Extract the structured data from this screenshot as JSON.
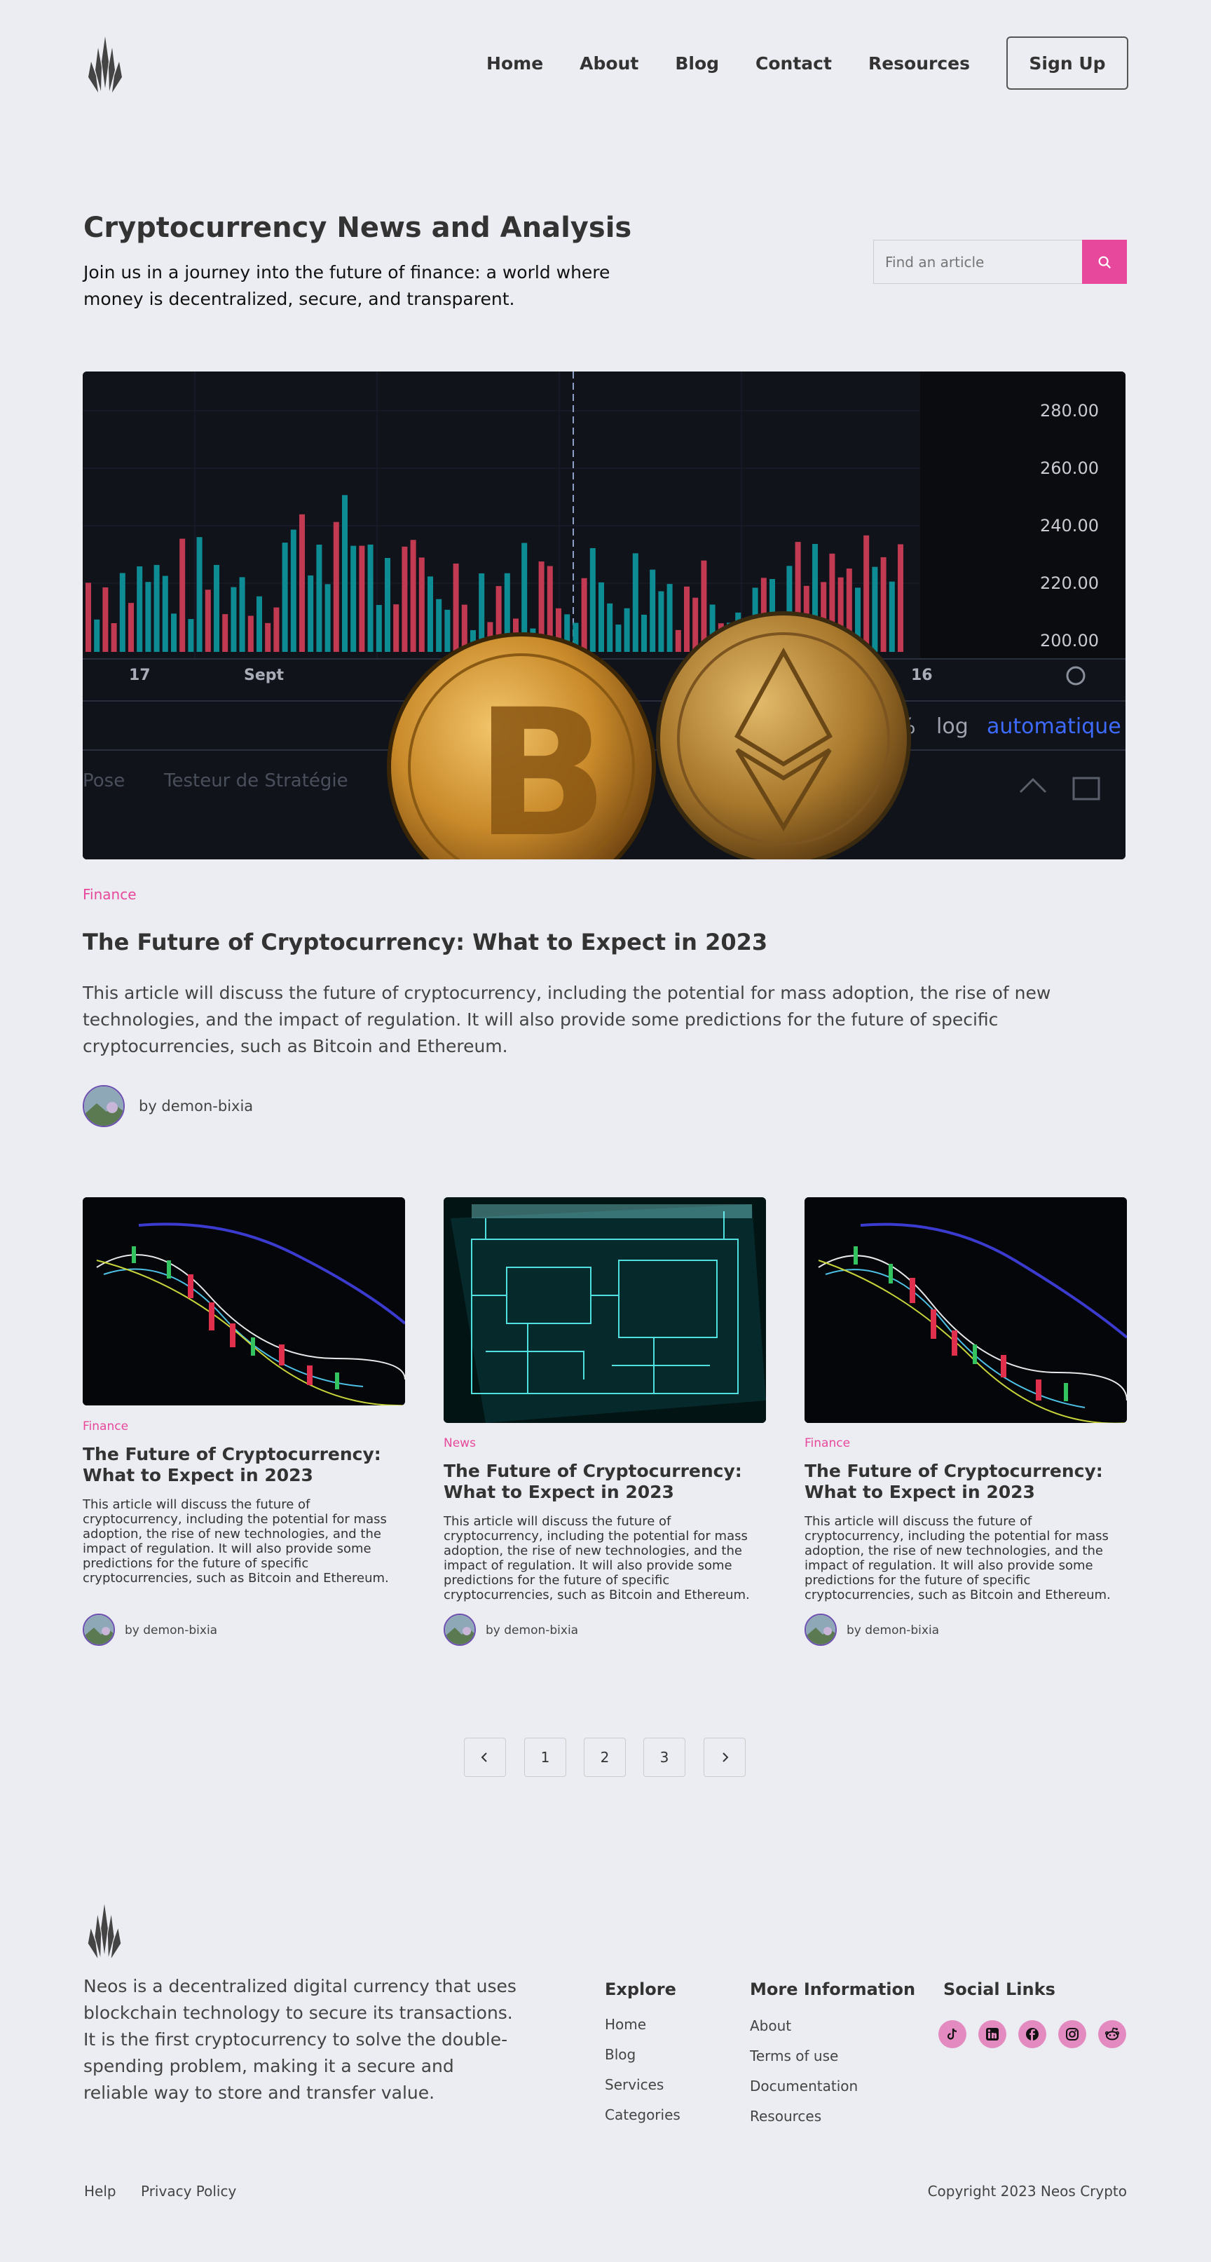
{
  "header": {
    "nav": [
      "Home",
      "About",
      "Blog",
      "Contact",
      "Resources"
    ],
    "signup_label": "Sign Up"
  },
  "hero": {
    "title": "Cryptocurrency News and Analysis",
    "subtitle": "Join us in a journey into the future of finance: a world where money is decentralized, secure, and transparent.",
    "search_placeholder": "Find an article"
  },
  "featured": {
    "chart_ticks": [
      "280.00",
      "260.00",
      "240.00",
      "220.00",
      "200.00"
    ],
    "chart_x_labels": [
      "17",
      "Sept",
      "16"
    ],
    "chart_controls": [
      "%",
      "log",
      "automatique"
    ],
    "chart_bottom": [
      "Pose",
      "Testeur de Stratégie"
    ],
    "tag": "Finance",
    "title": "The Future of Cryptocurrency: What to Expect in 2023",
    "excerpt": "This article will discuss the future of cryptocurrency, including the potential for mass adoption, the rise of new technologies, and the impact of regulation. It will also provide some predictions for the future of specific cryptocurrencies, such as Bitcoin and Ethereum.",
    "author": "by demon-bixia"
  },
  "posts": [
    {
      "tag": "Finance",
      "title": "The Future of Cryptocurrency: What to Expect in 2023",
      "excerpt": "This article will discuss the future of cryptocurrency, including the potential for mass adoption, the rise of new technologies, and the impact of regulation. It will also provide some predictions for the future of specific cryptocurrencies, such as Bitcoin and Ethereum.",
      "author": "by demon-bixia"
    },
    {
      "tag": "News",
      "title": "The Future of Cryptocurrency: What to Expect in 2023",
      "excerpt": "This article will discuss the future of cryptocurrency, including the potential for mass adoption, the rise of new technologies, and the impact of regulation. It will also provide some predictions for the future of specific cryptocurrencies, such as Bitcoin and Ethereum.",
      "author": "by demon-bixia"
    },
    {
      "tag": "Finance",
      "title": "The Future of Cryptocurrency: What to Expect in 2023",
      "excerpt": "This article will discuss the future of cryptocurrency, including the potential for mass adoption, the rise of new technologies, and the impact of regulation. It will also provide some predictions for the future of specific cryptocurrencies, such as Bitcoin and Ethereum.",
      "author": "by demon-bixia"
    }
  ],
  "pagination": {
    "pages": [
      "1",
      "2",
      "3"
    ]
  },
  "footer": {
    "about": "Neos is a decentralized digital currency that uses blockchain technology to secure its transactions. It is the first cryptocurrency to solve the double-spending problem, making it a secure and reliable way to store and transfer value.",
    "explore_heading": "Explore",
    "explore_links": [
      "Home",
      "Blog",
      "Services",
      "Categories"
    ],
    "more_heading": "More Information",
    "more_links": [
      "About",
      "Terms of use",
      "Documentation",
      "Resources"
    ],
    "social_heading": "Social Links",
    "social_icons": [
      "tiktok-icon",
      "linkedin-icon",
      "facebook-icon",
      "instagram-icon",
      "reddit-icon"
    ],
    "bottom_links": [
      "Help",
      "Privacy Policy"
    ],
    "copyright": "Copyright 2023 Neos Crypto"
  },
  "colors": {
    "accent": "#e8489b",
    "background": "#ecedf2",
    "social_bg": "#e38bc1"
  }
}
